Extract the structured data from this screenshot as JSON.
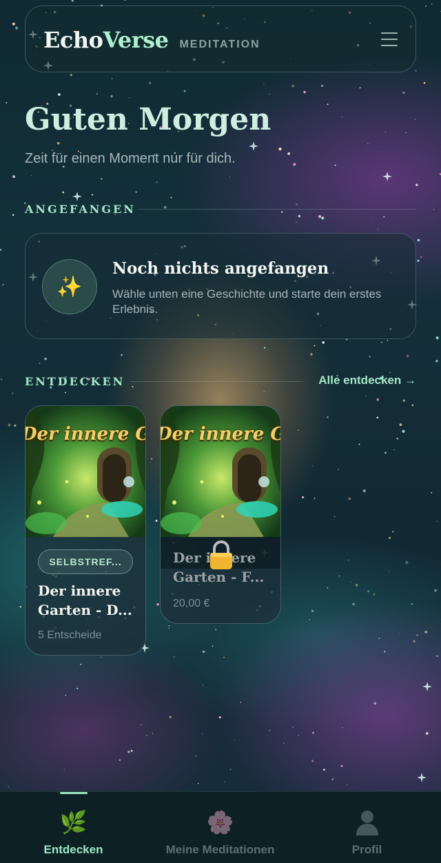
{
  "header": {
    "brand_echo": "Echo",
    "brand_verse": "Verse",
    "brand_sub": "MEDITATION",
    "menu_icon": "hamburger-icon"
  },
  "greeting": {
    "title": "Guten Morgen",
    "subtitle": "Zeit für einen Moment nur für dich."
  },
  "started": {
    "label": "ANGEFANGEN",
    "empty_icon": "sparkles-icon",
    "empty_title": "Noch nichts angefangen",
    "empty_text": "Wähle unten eine Geschichte und starte dein erstes Erlebnis."
  },
  "discover": {
    "label": "ENTDECKEN",
    "all_link": "Alle entdecken →",
    "cards": [
      {
        "cover_title": "Der innere Garten",
        "badge": "SELBSTREF...",
        "title": "Der innere Garten - D...",
        "meta": "5 Entscheide",
        "locked": false
      },
      {
        "cover_title": "Der innere Garten",
        "title": "Der innere Garten - F...",
        "meta": "20,00 €",
        "locked": true
      }
    ]
  },
  "nav": {
    "items": [
      {
        "label": "Entdecken",
        "icon": "herb-icon",
        "active": true
      },
      {
        "label": "Meine Meditationen",
        "icon": "cherry-blossom-icon",
        "active": false
      },
      {
        "label": "Profil",
        "icon": "person-icon",
        "active": false
      }
    ]
  },
  "colors": {
    "accent": "#9fe6c6",
    "brand_verse": "#aef0cf",
    "nav_background": "#0d2124"
  }
}
